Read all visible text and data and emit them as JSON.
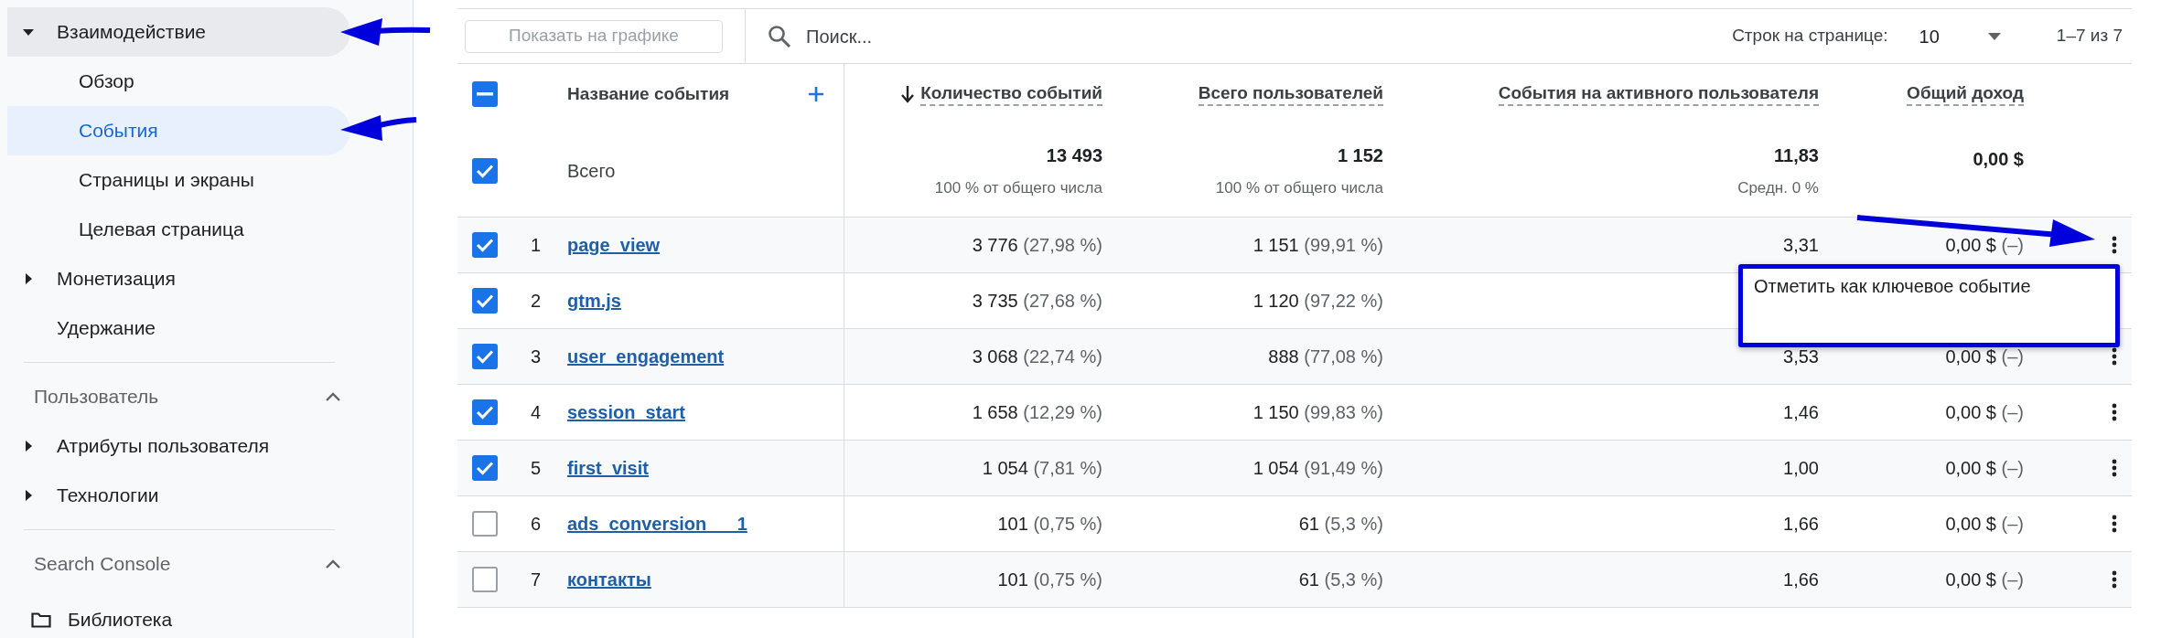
{
  "sidebar": {
    "sections": [
      {
        "items": [
          {
            "label": "Взаимодействие",
            "active": true,
            "selected": false,
            "expanded": true,
            "children": [
              {
                "label": "Обзор",
                "selected": false
              },
              {
                "label": "События",
                "selected": true
              },
              {
                "label": "Страницы и экраны",
                "selected": false
              },
              {
                "label": "Целевая страница",
                "selected": false
              }
            ]
          },
          {
            "label": "Монетизация",
            "active": false,
            "selected": false,
            "expanded": false
          },
          {
            "label": "Удержание",
            "active": false,
            "selected": false
          }
        ]
      },
      {
        "heading": "Пользователь",
        "expanded": true,
        "items": [
          {
            "label": "Атрибуты пользователя",
            "active": false,
            "selected": false,
            "expanded": false
          },
          {
            "label": "Технологии",
            "active": false,
            "selected": false,
            "expanded": false
          }
        ]
      },
      {
        "heading": "Search Console",
        "expanded": true
      }
    ],
    "library": {
      "label": "Библиотека"
    }
  },
  "toolbar": {
    "chart_button": {
      "label": "Показать на графике",
      "disabled": true
    },
    "search": {
      "placeholder": "Поиск..."
    },
    "rows_per_page": {
      "label": "Строк на странице:",
      "value": "10"
    },
    "range": "1–7 из 7"
  },
  "table": {
    "header_checkbox": {
      "indeterminate": true
    },
    "columns": [
      {
        "label": "Название события",
        "kind": "dimension"
      },
      {
        "label": "Количество событий",
        "kind": "metric",
        "sorted": true
      },
      {
        "label": "Всего пользователей",
        "kind": "metric",
        "sorted": false
      },
      {
        "label": "События на активного пользователя",
        "kind": "metric",
        "sorted": false
      },
      {
        "label": "Общий доход",
        "kind": "metric",
        "sorted": false
      }
    ],
    "totals": {
      "checked": true,
      "label": "Всего",
      "events": "13 493",
      "events_note": "100 % от общего числа",
      "users": "1 152",
      "users_note": "100 % от общего числа",
      "per_user": "11,83",
      "per_user_note": "Средн. 0 %",
      "revenue": "0,00 $"
    },
    "rows": [
      {
        "checked": true,
        "rank": "1",
        "name": "page_view",
        "events": "3 776",
        "events_share": "(27,98 %)",
        "users": "1 151",
        "users_share": "(99,91 %)",
        "per_user": "3,31",
        "revenue": "0,00 $",
        "revenue_share": "(–)",
        "menu": true
      },
      {
        "checked": true,
        "rank": "2",
        "name": "gtm.js",
        "events": "3 735",
        "events_share": "(27,68 %)",
        "users": "1 120",
        "users_share": "(97,22 %)"
      },
      {
        "checked": true,
        "rank": "3",
        "name": "user_engagement",
        "events": "3 068",
        "events_share": "(22,74 %)",
        "users": "888",
        "users_share": "(77,08 %)",
        "per_user": "3,53",
        "revenue": "0,00 $",
        "revenue_share": "(–)",
        "menu": true
      },
      {
        "checked": true,
        "rank": "4",
        "name": "session_start",
        "events": "1 658",
        "events_share": "(12,29 %)",
        "users": "1 150",
        "users_share": "(99,83 %)",
        "per_user": "1,46",
        "revenue": "0,00 $",
        "revenue_share": "(–)",
        "menu": true
      },
      {
        "checked": true,
        "rank": "5",
        "name": "first_visit",
        "events": "1 054",
        "events_share": "(7,81 %)",
        "users": "1 054",
        "users_share": "(91,49 %)",
        "per_user": "1,00",
        "revenue": "0,00 $",
        "revenue_share": "(–)",
        "menu": true
      },
      {
        "checked": false,
        "rank": "6",
        "name": "ads_conversion___1",
        "events": "101",
        "events_share": "(0,75 %)",
        "users": "61",
        "users_share": "(5,3 %)",
        "per_user": "1,66",
        "revenue": "0,00 $",
        "revenue_share": "(–)",
        "menu": true
      },
      {
        "checked": false,
        "rank": "7",
        "name": "контакты",
        "events": "101",
        "events_share": "(0,75 %)",
        "users": "61",
        "users_share": "(5,3 %)",
        "per_user": "1,66",
        "revenue": "0,00 $",
        "revenue_share": "(–)",
        "menu": true
      }
    ]
  },
  "context_menu": {
    "items": [
      {
        "label": "Отметить как ключевое событие"
      }
    ]
  }
}
